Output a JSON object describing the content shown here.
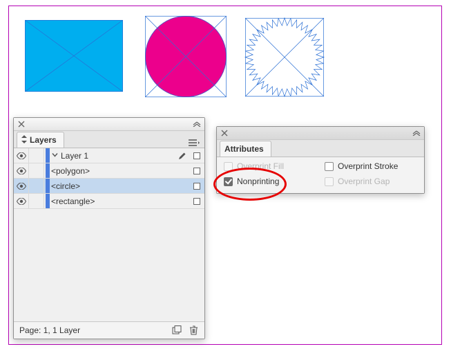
{
  "colors": {
    "selection": "#2a6fd4",
    "artboard_border": "#b400b4",
    "rect_fill": "#00aeef",
    "circle_fill": "#ec008c",
    "star_fill": "#fff200",
    "layer_color": "#4a7dde"
  },
  "layers_panel": {
    "tab_label": "Layers",
    "items": [
      {
        "name": "Layer 1",
        "type": "layer",
        "expanded": true,
        "selected": false,
        "has_pencil": true
      },
      {
        "name": "<polygon>",
        "type": "object",
        "selected": false
      },
      {
        "name": "<circle>",
        "type": "object",
        "selected": true
      },
      {
        "name": "<rectangle>",
        "type": "object",
        "selected": false
      }
    ],
    "footer_text": "Page: 1, 1 Layer"
  },
  "attributes_panel": {
    "tab_label": "Attributes",
    "options": [
      {
        "key": "overprint_fill",
        "label": "Overprint Fill",
        "checked": false,
        "enabled": false
      },
      {
        "key": "overprint_stroke",
        "label": "Overprint Stroke",
        "checked": false,
        "enabled": true
      },
      {
        "key": "nonprinting",
        "label": "Nonprinting",
        "checked": true,
        "enabled": true
      },
      {
        "key": "overprint_gap",
        "label": "Overprint Gap",
        "checked": false,
        "enabled": false
      }
    ]
  }
}
